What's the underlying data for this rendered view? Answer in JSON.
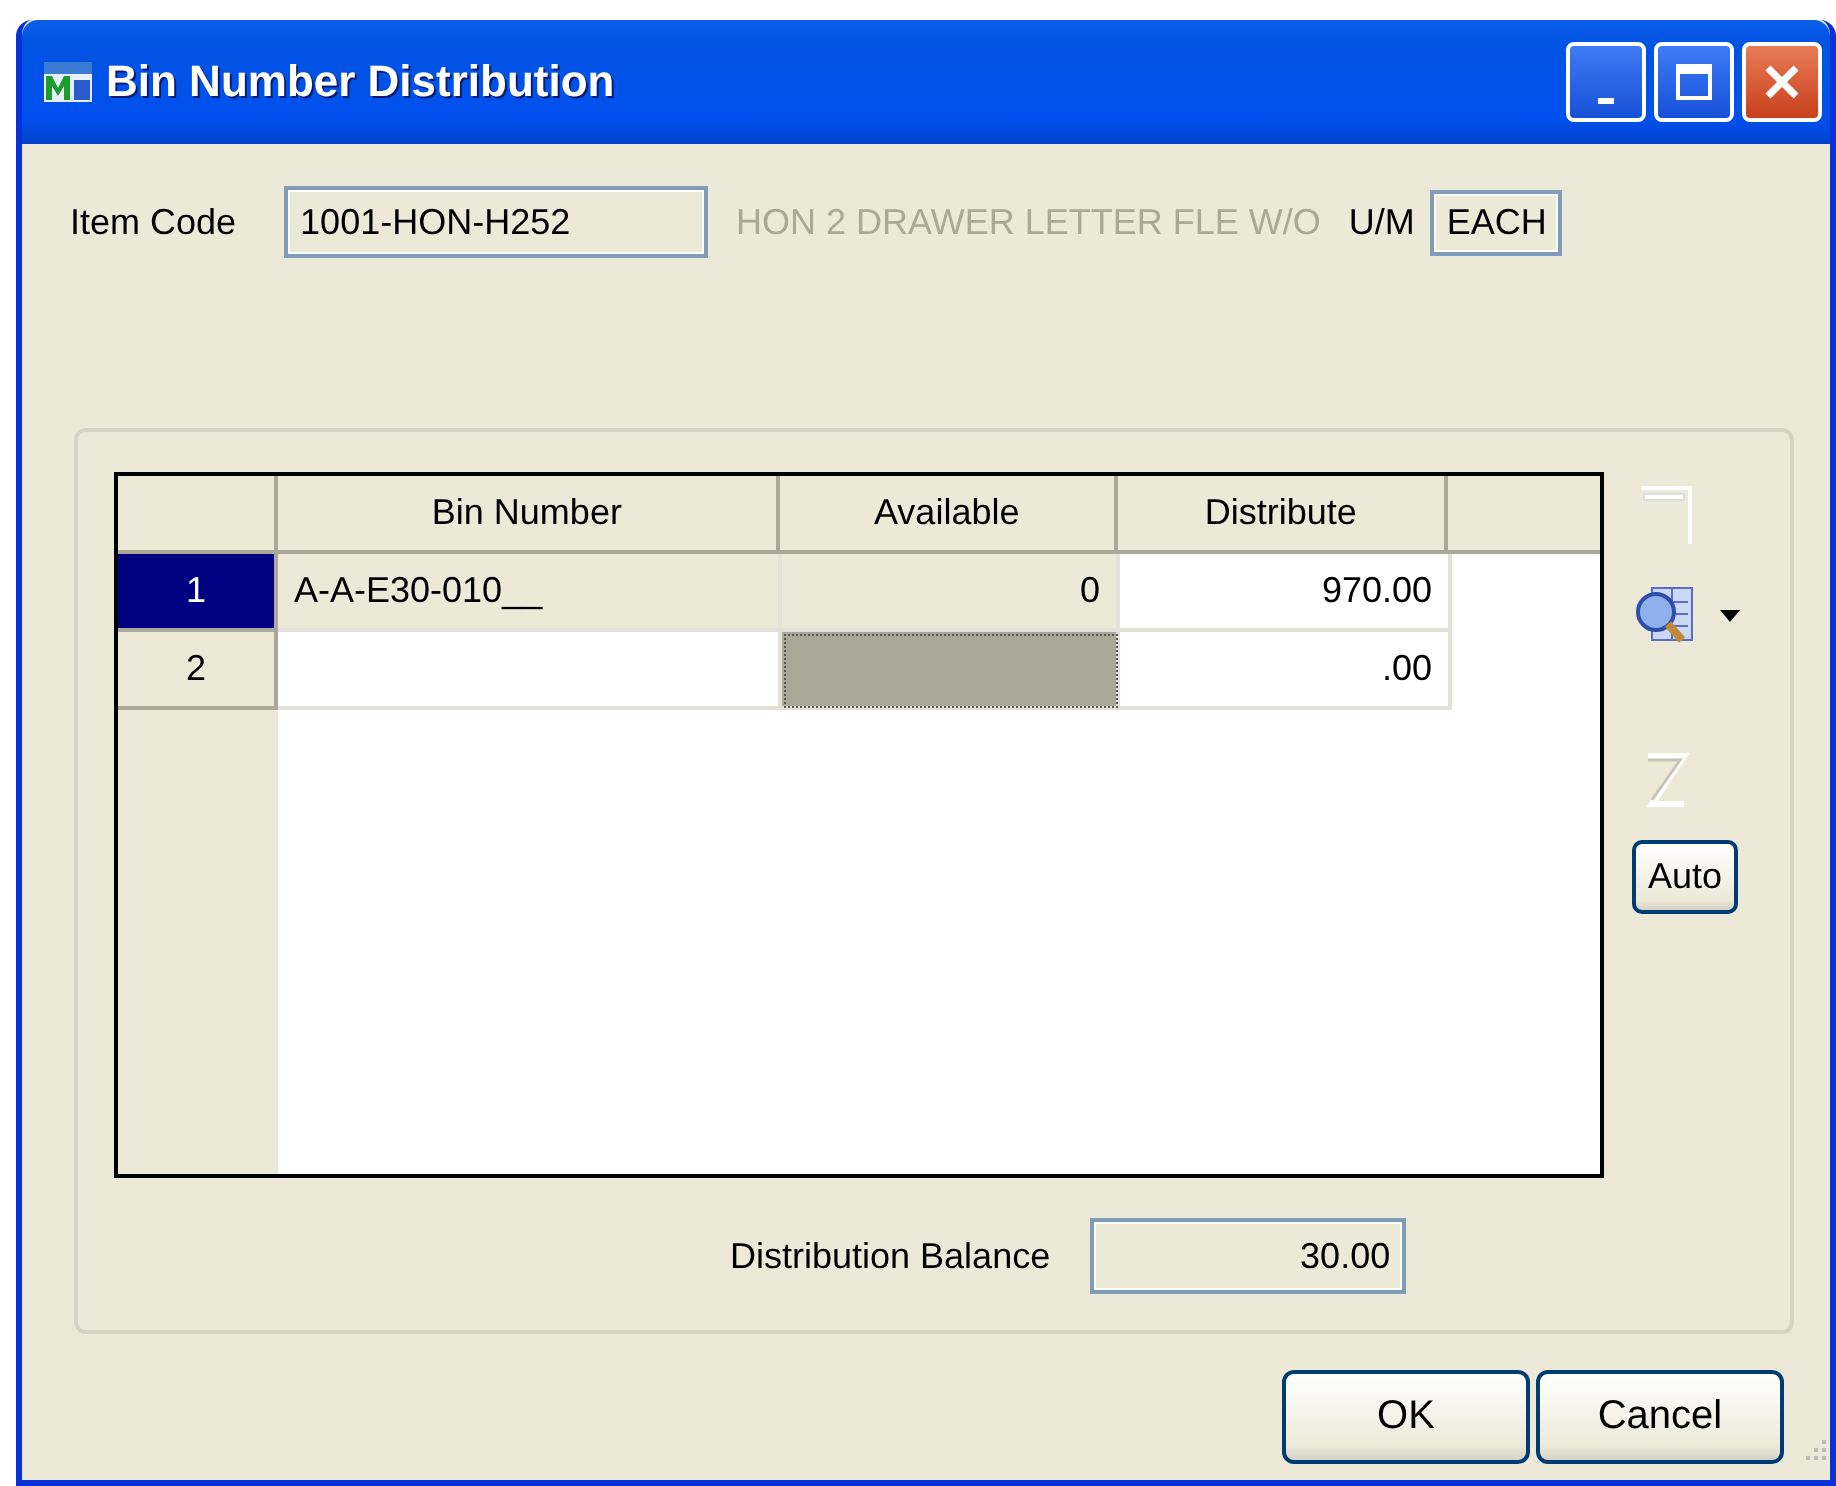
{
  "window": {
    "title": "Bin Number Distribution"
  },
  "item": {
    "label": "Item Code",
    "code": "1001-HON-H252",
    "description": "HON 2 DRAWER LETTER FLE W/O",
    "um_label": "U/M",
    "um": "EACH"
  },
  "table": {
    "columns": [
      "Bin Number",
      "Available",
      "Distribute"
    ],
    "rows": [
      {
        "number": "1",
        "selected": true,
        "cells": [
          {
            "text": "A-A-E30-010__",
            "readonly": true,
            "focused": false
          },
          {
            "text": "0",
            "readonly": true,
            "focused": false
          },
          {
            "text": "970.00",
            "readonly": false,
            "focused": false
          }
        ]
      },
      {
        "number": "2",
        "selected": false,
        "cells": [
          {
            "text": "",
            "readonly": false,
            "focused": false
          },
          {
            "text": "",
            "readonly": true,
            "focused": true
          },
          {
            "text": ".00",
            "readonly": false,
            "focused": false
          }
        ]
      }
    ]
  },
  "auto_button": "Auto",
  "balance": {
    "label": "Distribution Balance",
    "value": "30.00"
  },
  "buttons": [
    "OK",
    "Cancel"
  ]
}
